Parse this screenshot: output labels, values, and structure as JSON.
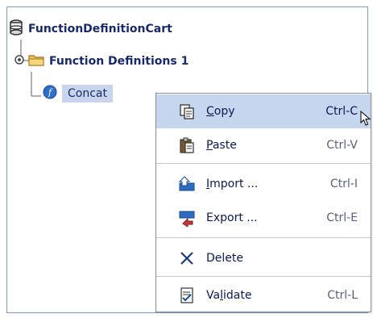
{
  "tree": {
    "root": {
      "label": "FunctionDefinitionCart",
      "icon": "database-icon"
    },
    "folder": {
      "label": "Function Definitions 1",
      "icon": "folder-icon"
    },
    "leaf": {
      "label": "Concat",
      "icon": "function-icon"
    }
  },
  "context_menu": {
    "items": [
      {
        "label": "Copy",
        "mnemonic": "C",
        "shortcut": "Ctrl-C",
        "icon": "copy-icon",
        "highlighted": true
      },
      {
        "label": "Paste",
        "mnemonic": "P",
        "shortcut": "Ctrl-V",
        "icon": "paste-icon"
      },
      {
        "label": "Import ...",
        "mnemonic": "I",
        "shortcut": "Ctrl-I",
        "icon": "import-icon"
      },
      {
        "label": "Export ...",
        "mnemonic": "",
        "shortcut": "Ctrl-E",
        "icon": "export-icon"
      },
      {
        "label": "Delete",
        "mnemonic": "",
        "shortcut": "",
        "icon": "delete-icon"
      },
      {
        "label": "Validate",
        "mnemonic": "l",
        "shortcut": "Ctrl-L",
        "icon": "validate-icon"
      }
    ]
  },
  "colors": {
    "selection": "#c6d6ee",
    "text": "#0b1a4d",
    "border": "#7f9db9"
  }
}
